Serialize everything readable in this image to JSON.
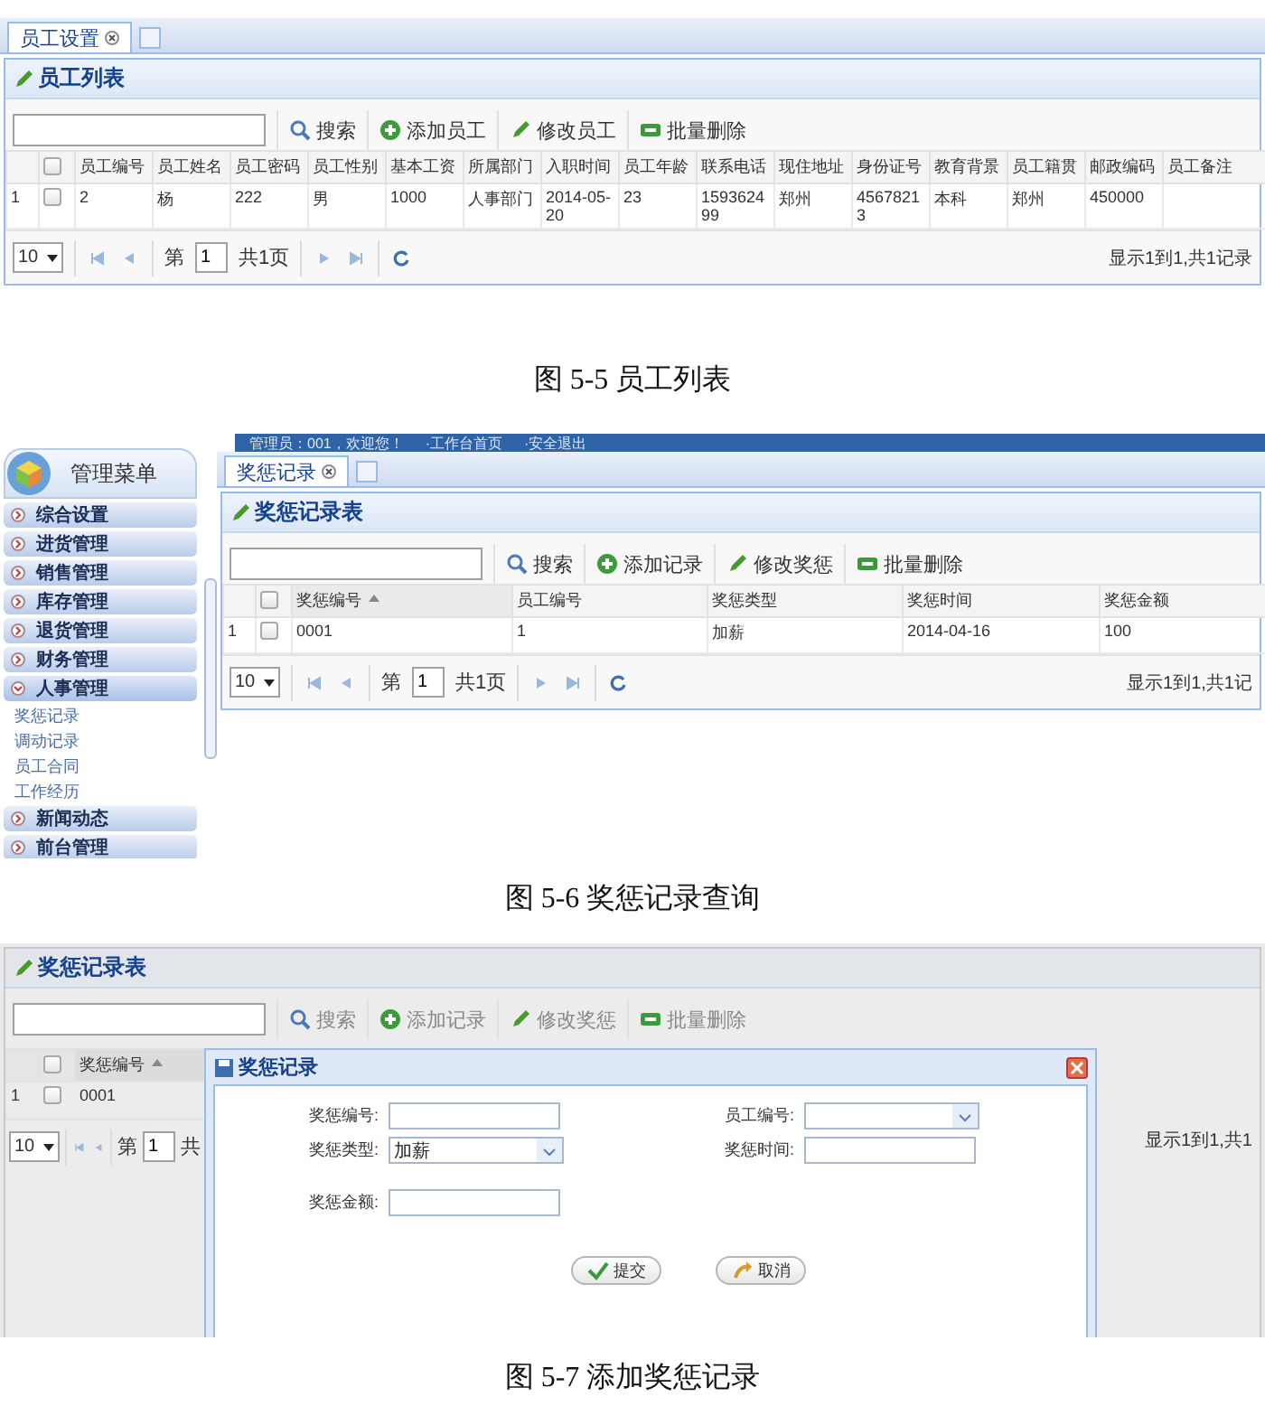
{
  "figure_1": {
    "tab": {
      "label": "员工设置",
      "selected": true
    },
    "panel_title": "员工列表",
    "toolbar": [
      {
        "kind": "search",
        "label": "搜索"
      },
      {
        "kind": "add",
        "label": "添加员工"
      },
      {
        "kind": "edit",
        "label": "修改员工"
      },
      {
        "kind": "delete",
        "label": "批量删除"
      }
    ],
    "header_checkbox": {
      "checked": false
    },
    "columns": [
      {
        "label": "员工编号"
      },
      {
        "label": "员工姓名"
      },
      {
        "label": "员工密码"
      },
      {
        "label": "员工性别"
      },
      {
        "label": "基本工资"
      },
      {
        "label": "所属部门"
      },
      {
        "label": "入职时间"
      },
      {
        "label": "员工年龄"
      },
      {
        "label": "联系电话"
      },
      {
        "label": "现住地址"
      },
      {
        "label": "身份证号"
      },
      {
        "label": "教育背景"
      },
      {
        "label": "员工籍贯"
      },
      {
        "label": "邮政编码"
      },
      {
        "label": "员工备注"
      }
    ],
    "rows": [
      {
        "number": "1",
        "checked": false,
        "cells": [
          "2",
          "杨",
          "222",
          "男",
          "1000",
          "人事部门",
          "2014-05-20",
          "23",
          "159362499",
          "郑州",
          "45678213",
          "本科",
          "郑州",
          "450000"
        ]
      }
    ],
    "pager": {
      "page_size": "10",
      "page_prefix": "第",
      "page": "1",
      "page_total": "共1页",
      "summary": "显示1到1,共1记录"
    },
    "caption": "图 5-5 员工列表"
  },
  "figure_2": {
    "header_texts": [
      "管理员：001，欢迎您！",
      "·工作台首页",
      "·安全退出"
    ],
    "menu": {
      "title": "管理菜单",
      "items": [
        {
          "label": "综合设置",
          "expanded": false
        },
        {
          "label": "进货管理",
          "expanded": false
        },
        {
          "label": "销售管理",
          "expanded": false
        },
        {
          "label": "库存管理",
          "expanded": false
        },
        {
          "label": "退货管理",
          "expanded": false
        },
        {
          "label": "财务管理",
          "expanded": false
        },
        {
          "label": "人事管理",
          "expanded": true,
          "children": [
            {
              "label": "奖惩记录"
            },
            {
              "label": "调动记录"
            },
            {
              "label": "员工合同"
            },
            {
              "label": "工作经历"
            }
          ]
        },
        {
          "label": "新闻动态",
          "expanded": false
        },
        {
          "label": "前台管理",
          "expanded": false
        }
      ]
    },
    "tab": {
      "label": "奖惩记录",
      "selected": true
    },
    "panel_title": "奖惩记录表",
    "toolbar": [
      {
        "kind": "search",
        "label": "搜索"
      },
      {
        "kind": "add",
        "label": "添加记录"
      },
      {
        "kind": "edit",
        "label": "修改奖惩"
      },
      {
        "kind": "delete",
        "label": "批量删除"
      }
    ],
    "header_checkbox": {
      "checked": false
    },
    "columns": [
      {
        "label": "奖惩编号",
        "sorted": true
      },
      {
        "label": "员工编号",
        "sorted": false
      },
      {
        "label": "奖惩类型",
        "sorted": false
      },
      {
        "label": "奖惩时间",
        "sorted": false
      },
      {
        "label": "奖惩金额",
        "sorted": false
      }
    ],
    "rows": [
      {
        "number": "1",
        "checked": false,
        "cells": [
          "0001",
          "1",
          "加薪",
          "2014-04-16",
          "100"
        ]
      }
    ],
    "pager": {
      "page_size": "10",
      "page_prefix": "第",
      "page": "1",
      "page_total": "共1页",
      "summary": "显示1到1,共1记"
    },
    "caption": "图 5-6 奖惩记录查询"
  },
  "figure_3": {
    "panel_title": "奖惩记录表",
    "toolbar": [
      {
        "kind": "search",
        "label": "搜索"
      },
      {
        "kind": "add",
        "label": "添加记录"
      },
      {
        "kind": "edit",
        "label": "修改奖惩"
      },
      {
        "kind": "delete",
        "label": "批量删除"
      }
    ],
    "header_checkbox": {
      "checked": false
    },
    "columns": [
      {
        "label": "奖惩编号",
        "sorted": true
      }
    ],
    "rows": [
      {
        "number": "1",
        "checked": false,
        "cells": [
          "0001"
        ]
      }
    ],
    "pager": {
      "page_size": "10",
      "page_prefix": "第",
      "page": "1",
      "page_total": "共",
      "summary": "显示1到1,共1"
    },
    "dialog": {
      "title": "奖惩记录",
      "fields": [
        {
          "kind": "text",
          "label": "奖惩编号:"
        },
        {
          "kind": "select",
          "label": "员工编号:"
        },
        {
          "kind": "select",
          "label": "奖惩类型:",
          "value": "加薪"
        },
        {
          "kind": "text",
          "label": "奖惩时间:"
        },
        {
          "kind": "text",
          "label": "奖惩金额:"
        }
      ],
      "buttons": [
        {
          "kind": "submit",
          "label": "提交"
        },
        {
          "kind": "cancel",
          "label": "取消"
        }
      ]
    },
    "caption": "图 5-7 添加奖惩记录"
  }
}
